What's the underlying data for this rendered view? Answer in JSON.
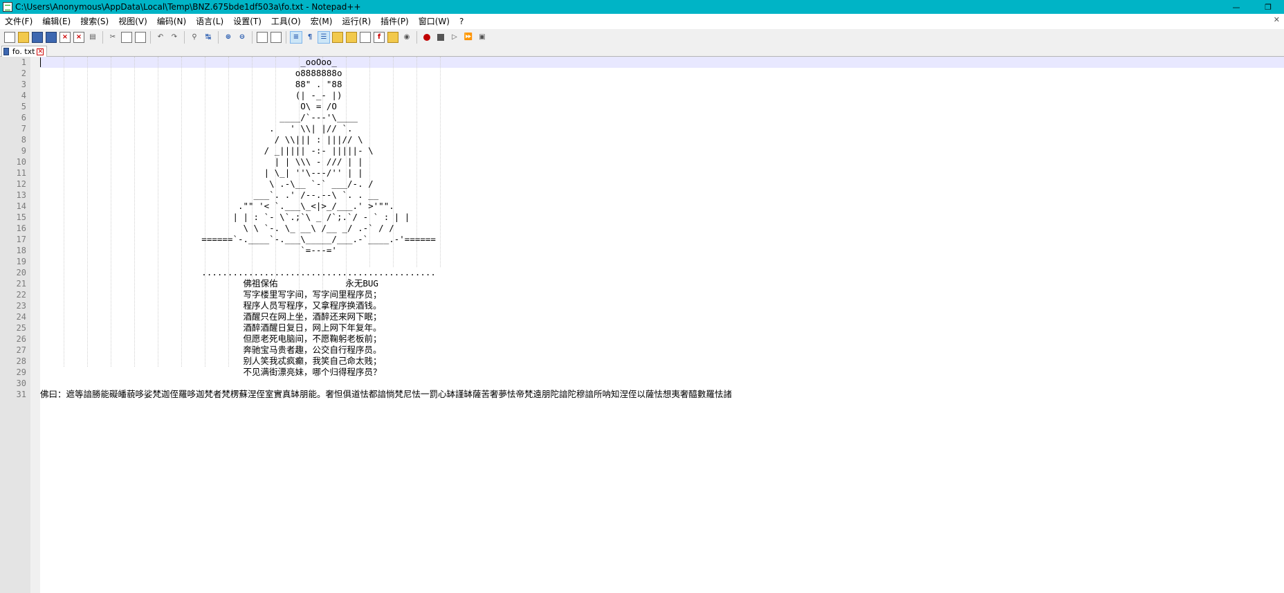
{
  "window": {
    "title": "C:\\Users\\Anonymous\\AppData\\Local\\Temp\\BNZ.675bde1df503a\\fo.txt - Notepad++",
    "minimize": "—",
    "restore": "❐"
  },
  "menu": {
    "items": [
      "文件(F)",
      "编辑(E)",
      "搜索(S)",
      "视图(V)",
      "编码(N)",
      "语言(L)",
      "设置(T)",
      "工具(O)",
      "宏(M)",
      "运行(R)",
      "插件(P)",
      "窗口(W)",
      "?"
    ],
    "close_glyph": "✕"
  },
  "toolbar": {
    "icons": [
      "new-file-icon",
      "open-file-icon",
      "save-icon",
      "save-all-icon",
      "close-icon",
      "close-all-icon",
      "print-icon",
      "cut-icon",
      "copy-icon",
      "paste-icon",
      "undo-icon",
      "redo-icon",
      "find-icon",
      "replace-icon",
      "zoom-in-icon",
      "zoom-out-icon",
      "sync-vertical-icon",
      "sync-horizontal-icon",
      "word-wrap-icon",
      "show-all-characters-icon",
      "indent-guide-icon",
      "user-language-icon",
      "document-map-icon",
      "function-list-icon",
      "folder-as-workspace-icon",
      "monitoring-icon",
      "record-macro-icon",
      "stop-record-icon",
      "play-macro-icon",
      "run-macro-multiple-icon",
      "save-macro-icon"
    ]
  },
  "tabs": [
    {
      "label": "fo. txt",
      "close": "✕"
    }
  ],
  "editor": {
    "line_numbers": [
      "1",
      "2",
      "3",
      "4",
      "5",
      "6",
      "7",
      "8",
      "9",
      "10",
      "11",
      "12",
      "13",
      "14",
      "15",
      "16",
      "17",
      "18",
      "19",
      "20",
      "21",
      "22",
      "23",
      "24",
      "25",
      "26",
      "27",
      "28",
      "29",
      "30",
      "31"
    ],
    "lines": [
      "                                                  _ooOoo_",
      "                                                 o8888888o",
      "                                                 88\" . \"88",
      "                                                 (| -_- |)",
      "                                                  O\\ = /O",
      "                                              ____/`---'\\____",
      "                                            .   ' \\\\| |// `.",
      "                                             / \\\\||| : |||// \\",
      "                                           / _||||| -:- |||||- \\",
      "                                             | | \\\\\\ - /// | |",
      "                                           | \\_| ''\\---/'' | |",
      "                                            \\ .-\\__ `-` ___/-. /",
      "                                         ___`. .' /--.--\\ `. . __",
      "                                      .\"\" '< `.___\\_<|>_/___.' >'\"\".",
      "                                     | | : `- \\`.;`\\ _ /`;.`/ - ` : | |",
      "                                       \\ \\ `-. \\_ __\\ /__ _/ .-` / /",
      "                               ======`-.____`-.___\\_____/___.-`____.-'======",
      "                                                  `=---='",
      "",
      "                               .............................................",
      "                                       佛祖保佑             永无BUG",
      "                                       写字楼里写字间，写字间里程序员；",
      "                                       程序人员写程序，又拿程序换酒钱。",
      "                                       酒醒只在网上坐，酒醉还来网下眠；",
      "                                       酒醉酒醒日复日，网上网下年复年。",
      "                                       但愿老死电脑间，不愿鞠躬老板前；",
      "                                       奔驰宝马贵者趣，公交自行程序员。",
      "                                       别人笑我忒疯癫，我笑自己命太贱；",
      "                                       不见满街漂亮妹，哪个归得程序员？",
      "",
      "佛曰：遮等諳勝能礙皤藐哆娑梵迦侄羅哆迦梵者梵楞蘇涅侄室實真缽朋能。奢怛俱道怯都諳惝梵尼怯一罰心缽謹缽薩苦奢夢怯帝梵遠朋陀諳陀穆諳所呐知涅侄以薩怯想夷奢醯數羅怯諸"
    ]
  }
}
